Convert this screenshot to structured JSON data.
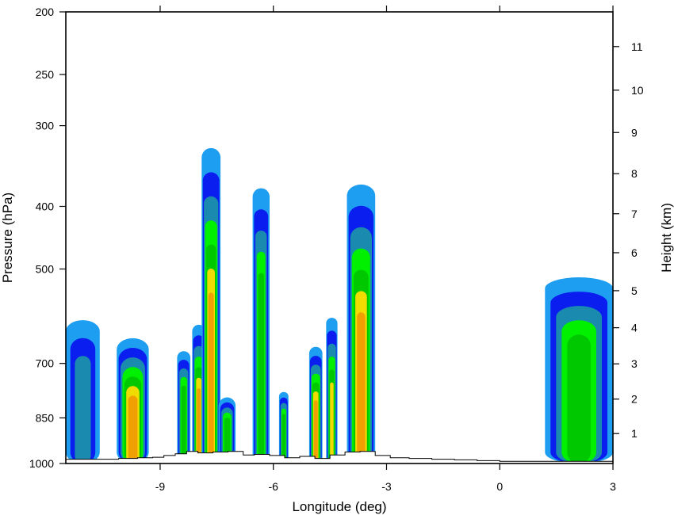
{
  "chart_data": {
    "type": "contour_cross_section",
    "xlabel": "Longitude (deg)",
    "ylabel": "Pressure (hPa)",
    "y2label": "Height (km)",
    "xlim": [
      -11.5,
      3
    ],
    "ylim": [
      1000,
      200
    ],
    "yscale": "log",
    "x_ticks": [
      -9,
      -6,
      -3,
      0,
      3
    ],
    "x_tick_labels": [
      "-9",
      "-6",
      "-3",
      "0",
      "3"
    ],
    "y_ticks": [
      200,
      250,
      300,
      400,
      500,
      700,
      850,
      1000
    ],
    "y_tick_labels": [
      "200",
      "250",
      "300",
      "400",
      "500",
      "700",
      "850",
      "1000"
    ],
    "y2_ticks": [
      1,
      2,
      3,
      4,
      5,
      6,
      7,
      8,
      9,
      10,
      11
    ],
    "y2_tick_labels": [
      "1",
      "2",
      "3",
      "4",
      "5",
      "6",
      "7",
      "8",
      "9",
      "10",
      "11"
    ],
    "level_colors": [
      "#1E9EF0",
      "#0A1EF0",
      "#1A8BAF",
      "#00F000",
      "#00C800",
      "#F0DC00",
      "#F0A000"
    ],
    "columns": [
      {
        "name": "col-west-edge",
        "lon_min": -11.5,
        "lon_max": -10.6,
        "top_hpa": 600,
        "peak_level": 2,
        "has_core": false
      },
      {
        "name": "col-lon-9.8",
        "lon_min": -10.15,
        "lon_max": -9.3,
        "top_hpa": 640,
        "peak_level": 6,
        "has_core": true
      },
      {
        "name": "col-lon-8.4",
        "lon_min": -8.55,
        "lon_max": -8.2,
        "top_hpa": 670,
        "peak_level": 4,
        "has_core": false
      },
      {
        "name": "col-lon-8.0",
        "lon_min": -8.15,
        "lon_max": -7.8,
        "top_hpa": 610,
        "peak_level": 6,
        "has_core": true
      },
      {
        "name": "col-lon-7.7",
        "lon_min": -7.9,
        "lon_max": -7.4,
        "top_hpa": 325,
        "peak_level": 6,
        "has_core": true
      },
      {
        "name": "col-lon-7.3",
        "lon_min": -7.45,
        "lon_max": -7.0,
        "top_hpa": 790,
        "peak_level": 4,
        "has_core": false
      },
      {
        "name": "col-lon-6.3",
        "lon_min": -6.55,
        "lon_max": -6.1,
        "top_hpa": 375,
        "peak_level": 4,
        "has_core": false
      },
      {
        "name": "col-lon-5.7",
        "lon_min": -5.85,
        "lon_max": -5.6,
        "top_hpa": 775,
        "peak_level": 4,
        "has_core": false
      },
      {
        "name": "col-lon-4.9",
        "lon_min": -5.05,
        "lon_max": -4.7,
        "top_hpa": 660,
        "peak_level": 6,
        "has_core": true
      },
      {
        "name": "col-lon-4.4",
        "lon_min": -4.6,
        "lon_max": -4.3,
        "top_hpa": 595,
        "peak_level": 5,
        "has_core": true
      },
      {
        "name": "col-lon-3.7",
        "lon_min": -4.05,
        "lon_max": -3.3,
        "top_hpa": 370,
        "peak_level": 6,
        "has_core": true
      },
      {
        "name": "col-east-edge",
        "lon_min": 1.2,
        "lon_max": 3.0,
        "top_hpa": 515,
        "peak_level": 4,
        "has_core": false
      }
    ],
    "terrain_hpa": [
      [
        -11.5,
        985
      ],
      [
        -10.4,
        985
      ],
      [
        -10.1,
        982
      ],
      [
        -9.6,
        980
      ],
      [
        -9.2,
        978
      ],
      [
        -8.9,
        972
      ],
      [
        -8.6,
        966
      ],
      [
        -8.3,
        958
      ],
      [
        -8.0,
        963
      ],
      [
        -7.6,
        960
      ],
      [
        -7.2,
        958
      ],
      [
        -6.8,
        970
      ],
      [
        -6.5,
        968
      ],
      [
        -6.1,
        972
      ],
      [
        -5.7,
        980
      ],
      [
        -5.3,
        975
      ],
      [
        -4.9,
        982
      ],
      [
        -4.5,
        970
      ],
      [
        -4.1,
        960
      ],
      [
        -3.7,
        958
      ],
      [
        -3.3,
        972
      ],
      [
        -2.9,
        980
      ],
      [
        -2.4,
        982
      ],
      [
        -1.8,
        985
      ],
      [
        -1.2,
        987
      ],
      [
        -0.6,
        990
      ],
      [
        0.0,
        992
      ],
      [
        0.6,
        992
      ],
      [
        1.4,
        992
      ],
      [
        3.0,
        995
      ]
    ]
  }
}
